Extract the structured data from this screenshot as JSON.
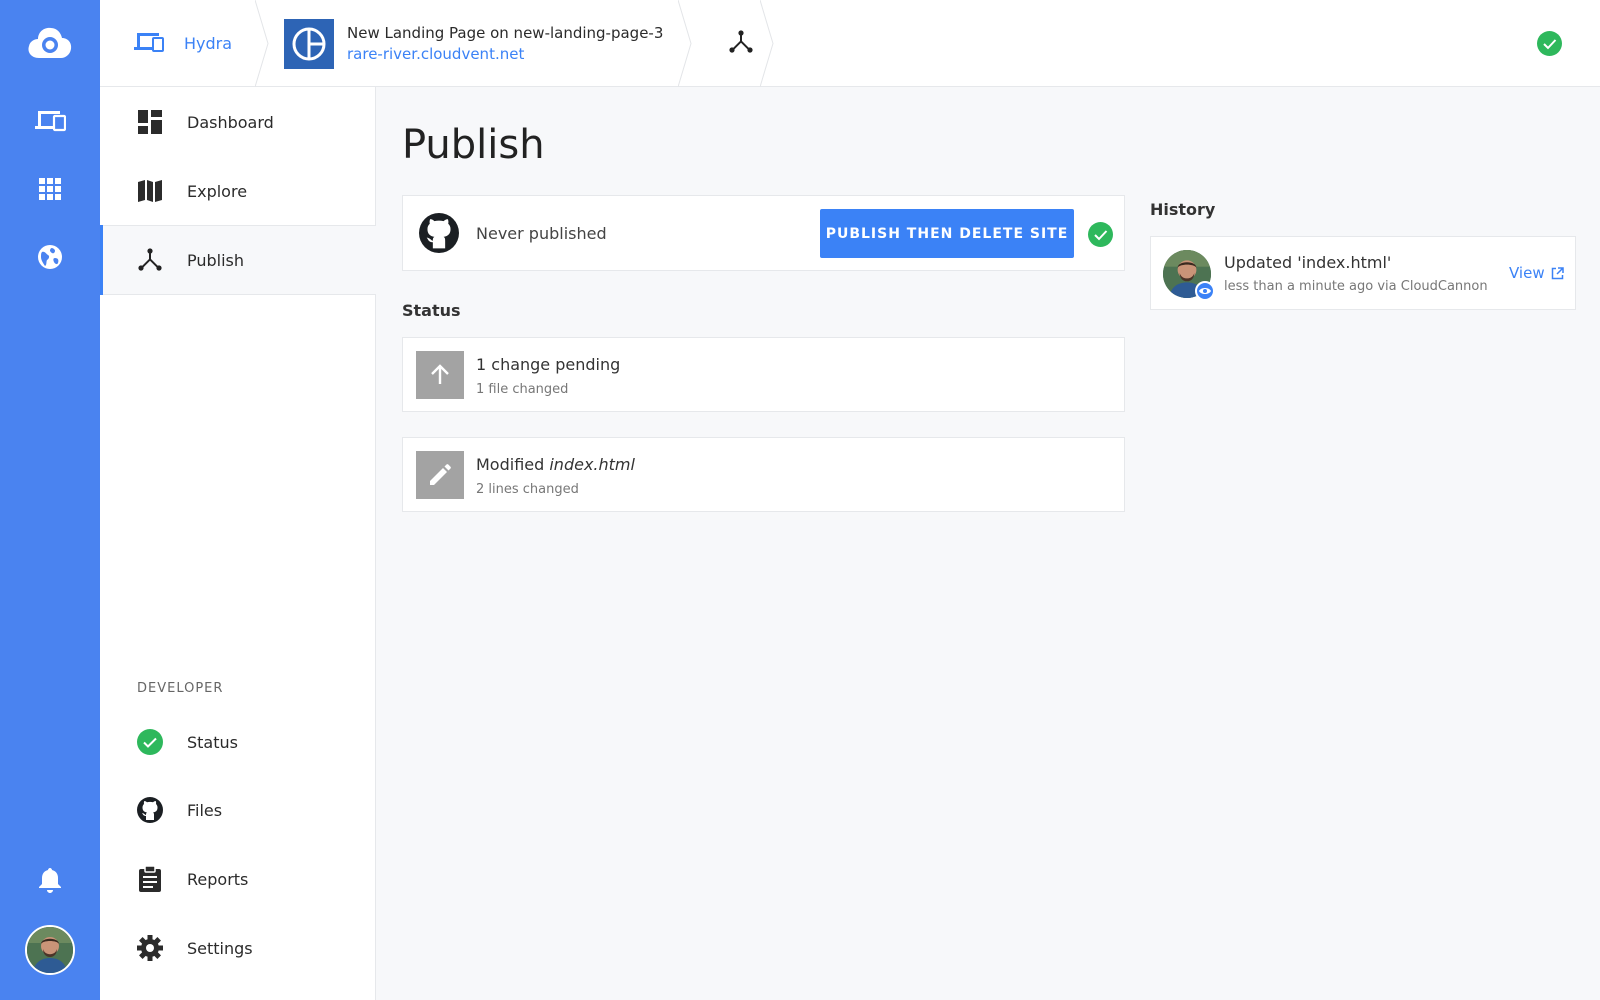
{
  "rail": {
    "logo": "cloudcannon-logo-icon",
    "items": [
      "devices-icon",
      "apps-grid-icon",
      "globe-icon"
    ],
    "bottom": [
      "bell-icon",
      "user-avatar"
    ]
  },
  "topbar": {
    "site_label": "Hydra",
    "project_title": "New Landing Page on new-landing-page-3",
    "project_url": "rare-river.cloudvent.net",
    "status": "ok"
  },
  "nav": {
    "items": [
      {
        "label": "Dashboard",
        "icon": "dashboard-icon"
      },
      {
        "label": "Explore",
        "icon": "map-icon"
      },
      {
        "label": "Publish",
        "icon": "merge-icon",
        "active": true
      }
    ],
    "developer_heading": "DEVELOPER",
    "developer_items": [
      {
        "label": "Status",
        "icon": "check-circle-icon"
      },
      {
        "label": "Files",
        "icon": "github-icon"
      },
      {
        "label": "Reports",
        "icon": "clipboard-icon"
      },
      {
        "label": "Settings",
        "icon": "gear-icon"
      }
    ]
  },
  "main": {
    "title": "Publish",
    "publish_card": {
      "status_text": "Never published",
      "button_label": "PUBLISH THEN DELETE SITE"
    },
    "status_heading": "Status",
    "changes": [
      {
        "icon": "arrow-up-icon",
        "title": "1 change pending",
        "subtitle": "1 file changed"
      },
      {
        "icon": "pencil-icon",
        "title_prefix": "Modified ",
        "title_file": "index.html",
        "subtitle": "2 lines changed"
      }
    ],
    "history_heading": "History",
    "history": [
      {
        "title": "Updated 'index.html'",
        "subtitle": "less than a minute ago via CloudCannon",
        "link": "View"
      }
    ]
  },
  "colors": {
    "accent": "#3b82f6",
    "rail": "#4a83f0",
    "success": "#2eb85c",
    "thumb": "#a3a3a3"
  }
}
